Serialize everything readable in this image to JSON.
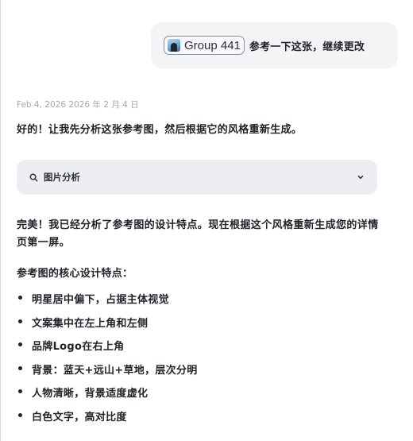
{
  "user_message": {
    "chip_label": "Group 441",
    "text": "参考一下这张，继续更改"
  },
  "assistant": {
    "timestamp": "Feb 4, 2026  2026 年 2 月 4 日",
    "intro": "好的！让我先分析这张参考图，然后根据它的风格重新生成。",
    "analysis_panel": {
      "label": "图片分析",
      "icon": "search-icon",
      "toggle_icon": "chevron-down-icon"
    },
    "summary": "完美！我已经分析了参考图的设计特点。现在根据这个风格重新生成您的详情页第一屏。",
    "features_title": "参考图的核心设计特点：",
    "features": [
      "明星居中偏下，占据主体视觉",
      "文案集中在左上角和左侧",
      "品牌Logo在右上角",
      "背景：蓝天+远山+草地，层次分明",
      "人物清晰，背景适度虚化",
      "白色文字，高对比度"
    ]
  }
}
